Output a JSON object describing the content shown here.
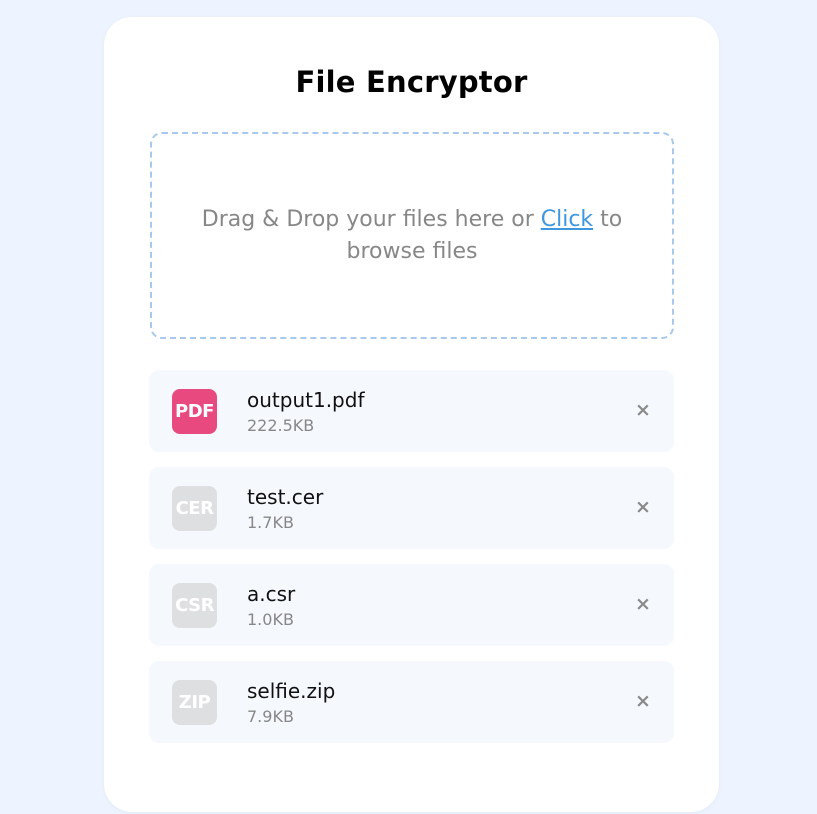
{
  "app": {
    "title": "File Encryptor"
  },
  "dropzone": {
    "text_before": "Drag & Drop your files here or ",
    "link_label": "Click",
    "text_after": " to browse files"
  },
  "files": [
    {
      "type_label": "PDF",
      "name": "output1.pdf",
      "size": "222.5KB",
      "remove_icon": "×"
    },
    {
      "type_label": "CER",
      "name": "test.cer",
      "size": "1.7KB",
      "remove_icon": "×"
    },
    {
      "type_label": "CSR",
      "name": "a.csr",
      "size": "1.0KB",
      "remove_icon": "×"
    },
    {
      "type_label": "ZIP",
      "name": "selfie.zip",
      "size": "7.9KB",
      "remove_icon": "×"
    }
  ],
  "colors": {
    "background": "#eef4ff",
    "card": "#ffffff",
    "dropzone_border": "#a8c8ec",
    "link": "#3f97dd",
    "pdf_badge": "#e8497f",
    "inactive_badge": "#dedfe1",
    "file_row": "#f5f8fd"
  }
}
